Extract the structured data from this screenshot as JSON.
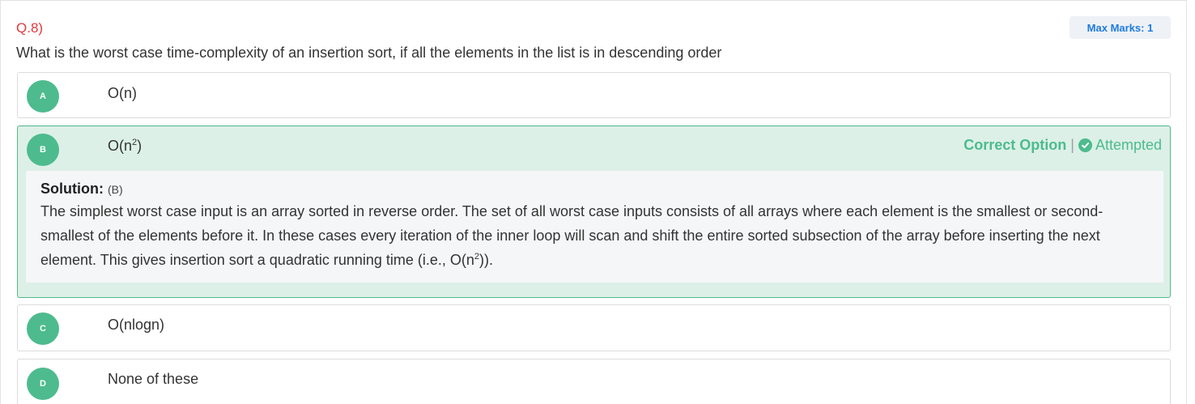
{
  "question": {
    "number": "Q.8)",
    "max_marks": "Max Marks: 1",
    "text": "What is the worst case time-complexity of an insertion sort, if all the elements in the list is in descending order"
  },
  "options": [
    {
      "letter": "A",
      "text": "O(n)"
    },
    {
      "letter": "B",
      "text_base": "O(n",
      "text_sup": "2",
      "text_end": ")"
    },
    {
      "letter": "C",
      "text": "O(nlogn)"
    },
    {
      "letter": "D",
      "text": "None of these"
    }
  ],
  "status": {
    "correct_label": "Correct Option",
    "separator": "|",
    "attempted_label": "Attempted",
    "icon": "check-circle-icon",
    "color": "#4dbb8e"
  },
  "solution": {
    "heading": "Solution:",
    "answer_key": "(B)",
    "body_main": "The simplest worst case input is an array sorted in reverse order. The set of all worst case inputs consists of all arrays where each element is the smallest or second-smallest of the elements before it. In these cases every iteration of the inner loop will scan and shift the entire sorted subsection of the array before inserting the next element. This gives insertion sort a quadratic running time (i.e., O(n",
    "body_sup": "2",
    "body_end": "))."
  },
  "colors": {
    "question_number": "#e0393e",
    "max_marks_text": "#1e7be0",
    "badge": "#4dbb8e",
    "correct_bg": "#dcf0e7"
  }
}
